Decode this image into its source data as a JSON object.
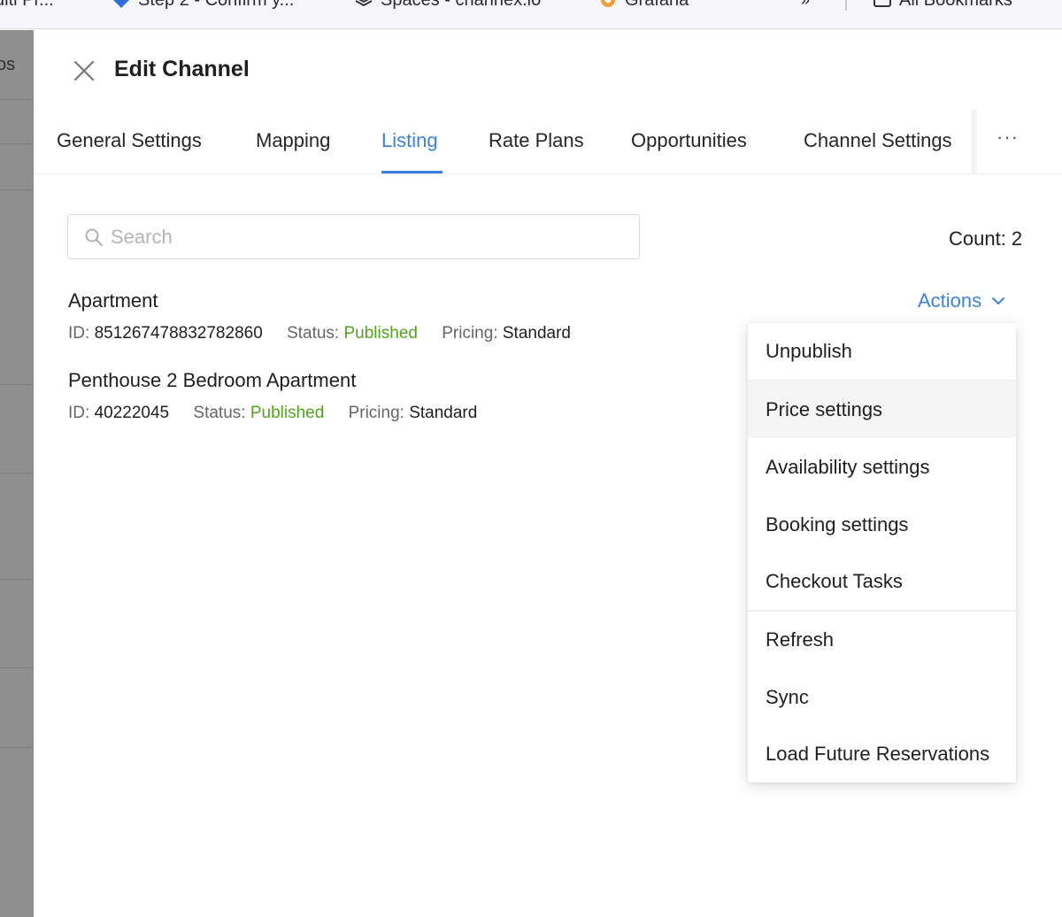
{
  "browser": {
    "bookmarks": [
      {
        "label": "ulti Pr...",
        "icon": "bookmark-icon"
      },
      {
        "label": "Step 2 - Confirm y...",
        "icon": "blue-diamond-icon"
      },
      {
        "label": "Spaces - channex.io",
        "icon": "layers-icon"
      },
      {
        "label": "Grafana",
        "icon": "grafana-icon"
      },
      {
        "label": "All Bookmarks",
        "icon": "folder-icon"
      }
    ],
    "more_label": "»"
  },
  "backdrop": {
    "partial_text": "os"
  },
  "drawer": {
    "title": "Edit Channel",
    "tabs": [
      {
        "label": "General Settings"
      },
      {
        "label": "Mapping"
      },
      {
        "label": "Listing",
        "active": true
      },
      {
        "label": "Rate Plans"
      },
      {
        "label": "Opportunities"
      },
      {
        "label": "Channel Settings"
      }
    ],
    "more_tabs_label": "···"
  },
  "search": {
    "placeholder": "Search",
    "value": ""
  },
  "count": {
    "label": "Count: 2"
  },
  "listings": [
    {
      "name": "Apartment",
      "id_label": "ID:",
      "id": "851267478832782860",
      "status_label": "Status:",
      "status": "Published",
      "pricing_label": "Pricing:",
      "pricing": "Standard"
    },
    {
      "name": "Penthouse 2 Bedroom Apartment",
      "id_label": "ID:",
      "id": "40222045",
      "status_label": "Status:",
      "status": "Published",
      "pricing_label": "Pricing:",
      "pricing": "Standard"
    }
  ],
  "actions": {
    "label": "Actions",
    "menu": [
      {
        "label": "Unpublish"
      },
      {
        "label": "Price settings",
        "hovered": true
      },
      {
        "label": "Availability settings"
      },
      {
        "label": "Booking settings"
      },
      {
        "label": "Checkout Tasks"
      },
      {
        "label": "Refresh"
      },
      {
        "label": "Sync"
      },
      {
        "label": "Load Future Reservations"
      }
    ]
  },
  "colors": {
    "accent": "#3b82e0",
    "published": "#52a41d",
    "backdrop": "#8f8f8f"
  }
}
